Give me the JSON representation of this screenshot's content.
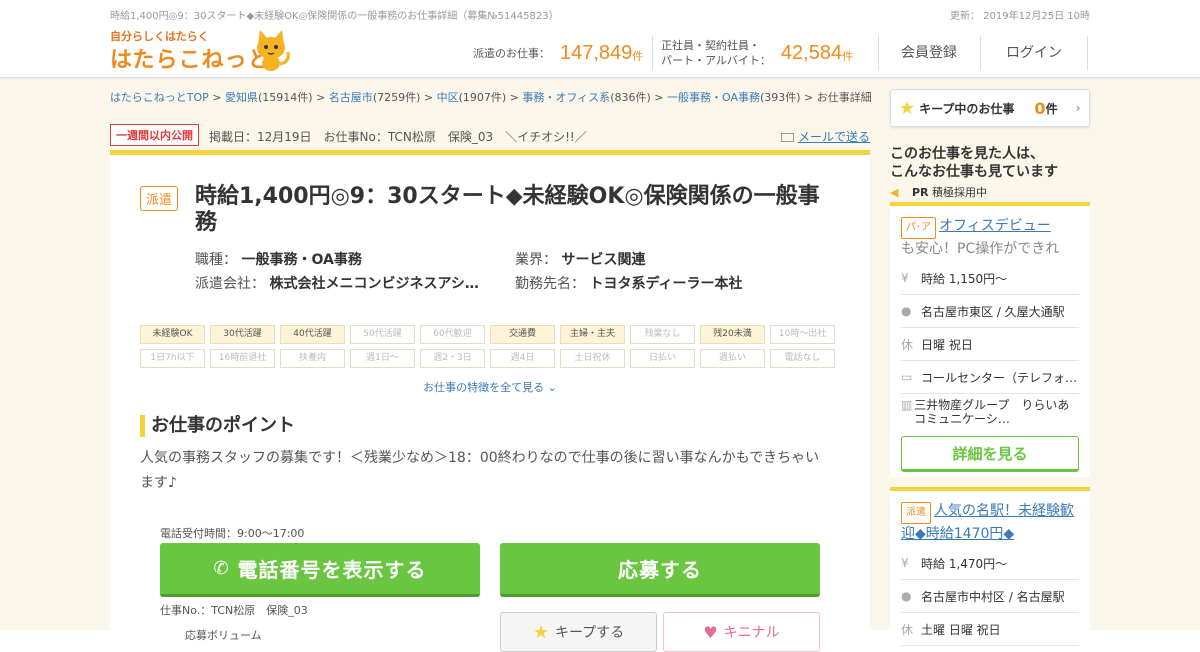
{
  "header": {
    "page_caption": "時給1,400円◎9：30スタート◆未経験OK◎保険関係の一般事務のお仕事詳細（募集№51445823）",
    "updated": "更新： 2019年12月25日 10時",
    "logo_small": "自分らしくはたらく",
    "logo_main": "はたらこねっと",
    "stat1_label": "派遣のお仕事：",
    "stat1_num": "147,849",
    "stat1_unit": "件",
    "stat2_label_1": "正社員・契約社員・",
    "stat2_label_2": "パート・アルバイト：",
    "stat2_num": "42,584",
    "stat2_unit": "件",
    "register": "会員登録",
    "login": "ログイン"
  },
  "breadcrumb": [
    {
      "text": "はたらこねっとTOP",
      "link": true
    },
    {
      "text": " > ",
      "link": false
    },
    {
      "text": "愛知県",
      "link": true
    },
    {
      "text": "(15914件) > ",
      "link": false
    },
    {
      "text": "名古屋市",
      "link": true
    },
    {
      "text": "(7259件) > ",
      "link": false
    },
    {
      "text": "中区",
      "link": true
    },
    {
      "text": "(1907件) > ",
      "link": false
    },
    {
      "text": "事務・オフィス系",
      "link": true
    },
    {
      "text": "(836件) > ",
      "link": false
    },
    {
      "text": "一般事務・OA事務",
      "link": true
    },
    {
      "text": "(393件) > お仕事詳細",
      "link": false
    }
  ],
  "job": {
    "new_badge": "一週間以内公開",
    "pub_info": "掲載日：12月19日　お仕事No：TCN松原　保険_03　＼イチオシ!!／",
    "mail_link": "メールで送る",
    "type_badge": "派遣",
    "title": "時給1,400円◎9：30スタート◆未経験OK◎保険関係の一般事務",
    "occupation_label": "職種：",
    "occupation": "一般事務・OA事務",
    "industry_label": "業界：",
    "industry": "サービス関連",
    "agency_label": "派遣会社：",
    "agency": "株式会社メニコンビジネスアシ…",
    "workplace_label": "勤務先名：",
    "workplace": "トヨタ系ディーラー本社",
    "tags": [
      {
        "t": "未経験OK",
        "on": true
      },
      {
        "t": "30代活躍",
        "on": true
      },
      {
        "t": "40代活躍",
        "on": true
      },
      {
        "t": "50代活躍",
        "on": false
      },
      {
        "t": "60代歓迎",
        "on": false
      },
      {
        "t": "交通費",
        "on": true
      },
      {
        "t": "主婦・主夫",
        "on": true
      },
      {
        "t": "残業なし",
        "on": false
      },
      {
        "t": "残20未満",
        "on": true
      },
      {
        "t": "10時～出社",
        "on": false
      },
      {
        "t": "1日7h以下",
        "on": false
      },
      {
        "t": "16時前退社",
        "on": false
      },
      {
        "t": "扶養内",
        "on": false
      },
      {
        "t": "週1日～",
        "on": false
      },
      {
        "t": "週2・3日",
        "on": false
      },
      {
        "t": "週4日",
        "on": false
      },
      {
        "t": "土日祝休",
        "on": false
      },
      {
        "t": "日払い",
        "on": false
      },
      {
        "t": "週払い",
        "on": false
      },
      {
        "t": "電話なし",
        "on": false
      }
    ],
    "all_features": "お仕事の特徴を全て見る",
    "point_heading": "お仕事のポイント",
    "point_text": "人気の事務スタッフの募集です！＜残業少なめ＞18：00終わりなので仕事の後に習い事なんかもできちゃいます♪",
    "phone_hours": "電話受付時間：9:00～17:00",
    "phone_button": "電話番号を表示する",
    "apply_button": "応募する",
    "job_no": "仕事No.：TCN松原　保険_03",
    "scale_label": "応募ボリューム",
    "keep_button": "キープする",
    "kininaru_button": "キニナル"
  },
  "sidebar": {
    "keep_label": "キープ中のお仕事",
    "keep_count": "0",
    "keep_unit": "件",
    "seen_line1": "このお仕事を見た人は、",
    "seen_line2": "こんなお仕事も見ています",
    "pr_label": "PR",
    "pr_text": "積極採用中",
    "rec1": {
      "type": "パ･ア",
      "title_link": "オフィスデビュー",
      "title_rest": "も安心！PC操作ができれ",
      "wage": "時給 1,150円～",
      "location": "名古屋市東区 / 久屋大通駅",
      "holiday": "日曜 祝日",
      "job": "コールセンター（テレフォ…",
      "company": "三井物産グループ　りらいあコミュニケーシ…",
      "detail": "詳細を見る"
    },
    "rec2": {
      "type": "派遣",
      "title": "人気の名駅！未経験歓迎◆時給1470円◆",
      "wage": "時給 1,470円～",
      "location": "名古屋市中村区 / 名古屋駅",
      "holiday": "土曜 日曜 祝日"
    }
  },
  "colors": {
    "accent": "#f08a1d",
    "green": "#6ac640",
    "yellow": "#f5d33a",
    "link": "#3a7ab8"
  }
}
